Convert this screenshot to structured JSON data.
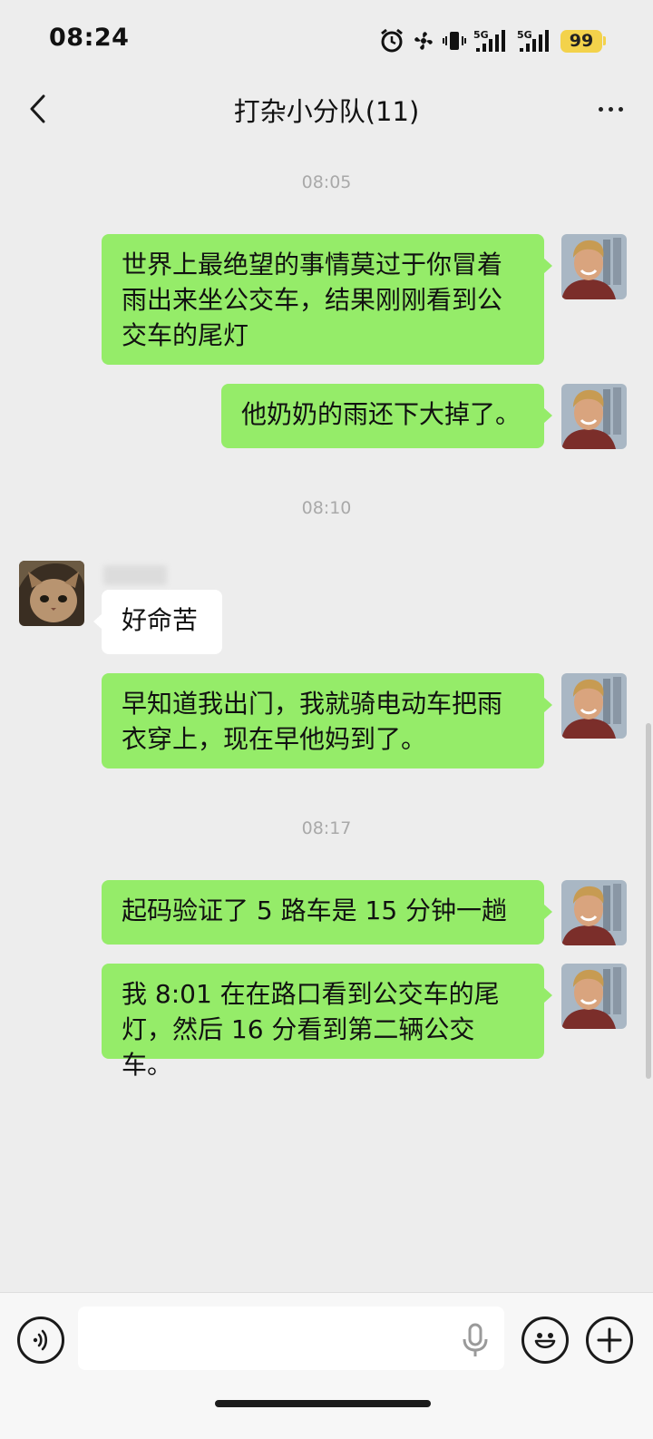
{
  "status_bar": {
    "time": "08:24",
    "battery_level": "99",
    "network_labels": [
      "5G",
      "5G"
    ],
    "icons": [
      "alarm-icon",
      "fan-icon",
      "vibrate-icon",
      "signal-icon",
      "signal-icon",
      "battery-icon"
    ]
  },
  "header": {
    "title": "打杂小分队(11)",
    "back_icon": "chevron-left-icon",
    "more_icon": "more-dots-icon"
  },
  "messages": [
    {
      "type": "timestamp",
      "text": "08:05"
    },
    {
      "type": "sent",
      "lines": [
        "世界上最绝望的事情莫过于你冒着",
        "雨出来坐公交车，结果刚刚看到公",
        "交车的尾灯"
      ]
    },
    {
      "type": "sent",
      "lines": [
        "他奶奶的雨还下大掉了。"
      ]
    },
    {
      "type": "timestamp",
      "text": "08:10"
    },
    {
      "type": "received",
      "lines": [
        "好命苦"
      ]
    },
    {
      "type": "sent",
      "lines": [
        "早知道我出门，我就骑电动车把雨",
        "衣穿上，现在早他妈到了。"
      ]
    },
    {
      "type": "timestamp",
      "text": "08:17"
    },
    {
      "type": "sent",
      "lines": [
        "起码验证了 5 路车是 15 分钟一趟"
      ]
    },
    {
      "type": "sent",
      "lines": [
        "我 8:01 在在路口看到公交车的尾",
        "灯，然后 16 分看到第二辆公交车。"
      ]
    }
  ],
  "input_bar": {
    "placeholder": "",
    "value": "",
    "icons": [
      "voice-icon",
      "mic-icon",
      "emoji-icon",
      "plus-icon"
    ]
  },
  "colors": {
    "background": "#ededed",
    "sent_bubble": "#95ec69",
    "received_bubble": "#ffffff",
    "battery": "#f3d24b",
    "timestamp": "#a9a9a9"
  }
}
